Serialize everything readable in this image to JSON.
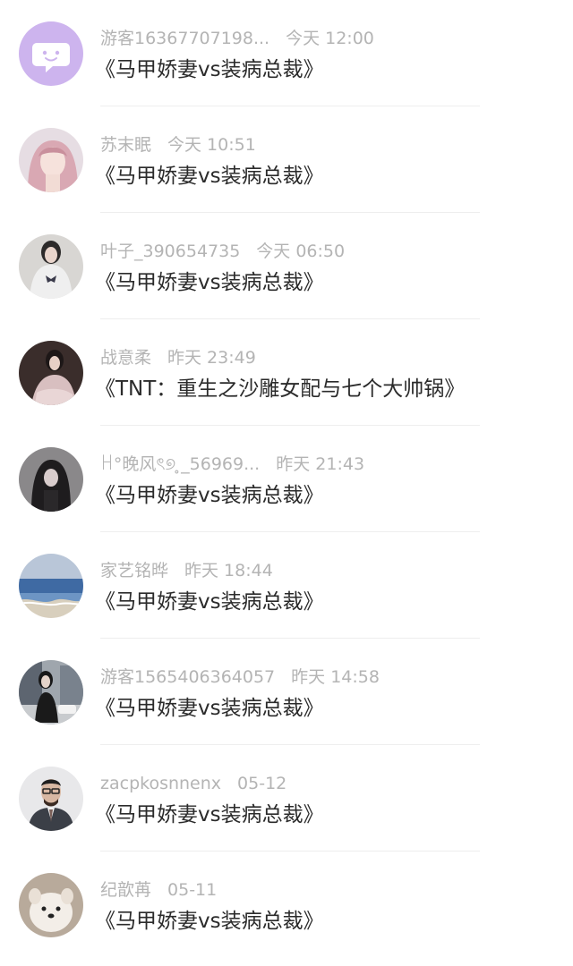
{
  "comments": [
    {
      "user": "游客16367707198...",
      "time": "今天 12:00",
      "book": "《马甲娇妻vs装病总裁》",
      "avatar": "chat-bubble-avatar",
      "color": "#cdb4ee"
    },
    {
      "user": "苏末眠",
      "time": "今天 10:51",
      "book": "《马甲娇妻vs装病总裁》",
      "avatar": "girl-pink-hair-avatar",
      "color": "#d9a8b3"
    },
    {
      "user": "叶子_390654735",
      "time": "今天 06:50",
      "book": "《马甲娇妻vs装病总裁》",
      "avatar": "girl-butterfly-shirt-avatar",
      "color": "#c9c6c2"
    },
    {
      "user": "战意柔",
      "time": "昨天 23:49",
      "book": "《TNT：重生之沙雕女配与七个大帅锅》",
      "avatar": "girl-dress-avatar",
      "color": "#7a5f58"
    },
    {
      "user": "ꀿ°晚风ৎ୭ ̥_56969...",
      "time": "昨天 21:43",
      "book": "《马甲娇妻vs装病总裁》",
      "avatar": "dark-hair-girl-avatar",
      "color": "#6c6a6c"
    },
    {
      "user": "家艺铭晔",
      "time": "昨天 18:44",
      "book": "《马甲娇妻vs装病总裁》",
      "avatar": "ocean-avatar",
      "color": "#6f93bf"
    },
    {
      "user": "游客1565406364057",
      "time": "昨天 14:58",
      "book": "《马甲娇妻vs装病总裁》",
      "avatar": "girl-city-avatar",
      "color": "#6a6c70"
    },
    {
      "user": "zacpkosnnenx",
      "time": "05-12",
      "book": "《马甲娇妻vs装病总裁》",
      "avatar": "man-suit-avatar",
      "color": "#555a63"
    },
    {
      "user": "纪歆苒",
      "time": "05-11",
      "book": "《马甲娇妻vs装病总裁》",
      "avatar": "dog-avatar",
      "color": "#c7b9ab"
    }
  ]
}
